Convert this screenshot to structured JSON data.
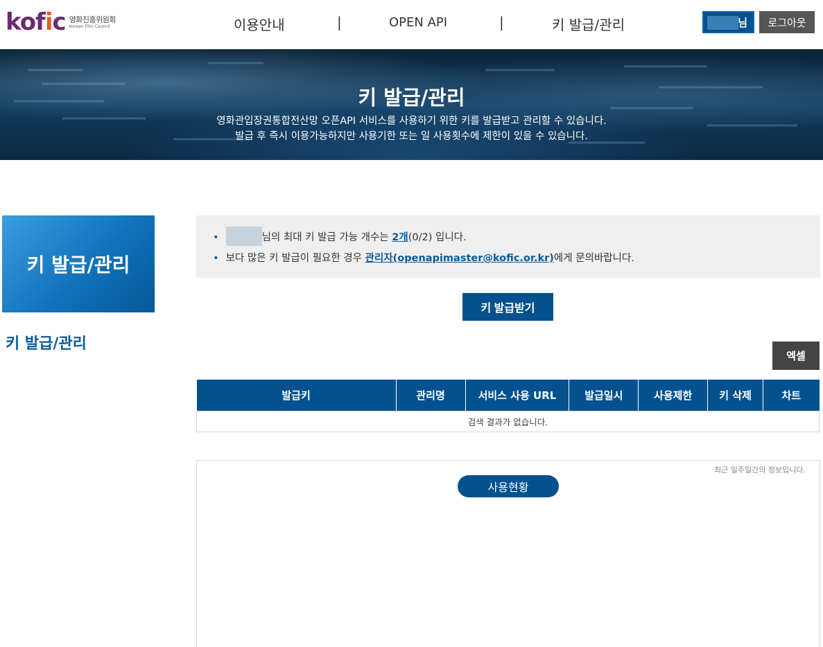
{
  "header": {
    "logo": {
      "mark": "kofic",
      "name_ko": "영화진흥위원회",
      "name_en": "Korean Film Council"
    },
    "nav": [
      {
        "label": "이용안내"
      },
      {
        "label": "OPEN API"
      },
      {
        "label": "키 발급/관리"
      }
    ],
    "nav_separator": "|",
    "user_suffix": "님",
    "logout_label": "로그아웃"
  },
  "banner": {
    "title": "키 발급/관리",
    "desc_line1": "영화관입장권통합전산망 오픈API 서비스를 사용하기 위한 키를 발급받고 관리할 수 있습니다.",
    "desc_line2": "발급 후 즉시 이용가능하지만 사용기한 또는 일 사용횟수에 제한이 있을 수 있습니다."
  },
  "sidebar": {
    "box_title": "키 발급/관리",
    "items": [
      {
        "label": "키 발급/관리"
      }
    ]
  },
  "info": {
    "line1_suffix": "님의 최대 키 발급 가능 개수는 ",
    "line1_count": "2개",
    "line1_count_detail": "(0/2) 입니다.",
    "line2_prefix": "보다 많은 키 발급이 필요한 경우 ",
    "line2_link": "관리자(openapimaster@kofic.or.kr)",
    "line2_suffix": "에게 문의바랍니다."
  },
  "issue_button": "키 발급받기",
  "excel_button": "엑셀",
  "table": {
    "columns": [
      "발급키",
      "관리명",
      "서비스 사용 URL",
      "발급일시",
      "사용제한",
      "키 삭제",
      "차트"
    ],
    "empty_message": "검색 결과가 없습니다."
  },
  "usage": {
    "note": "최근 일주일간의 정보입니다.",
    "button": "사용현황"
  },
  "colors": {
    "primary": "#03528f",
    "logo_purple": "#6a2c6e",
    "logo_orange": "#e85b2a",
    "dark_button": "#444444"
  }
}
